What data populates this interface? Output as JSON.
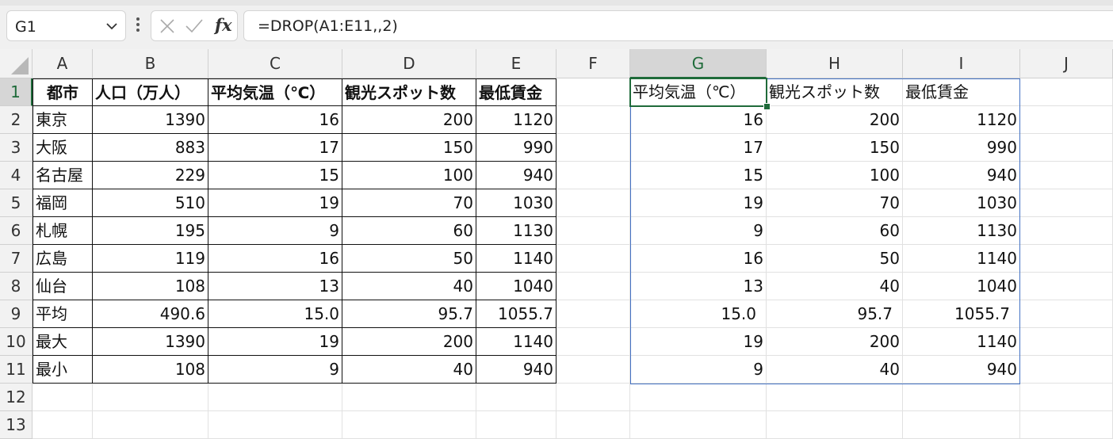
{
  "name_box": {
    "value": "G1"
  },
  "formula_bar": {
    "formula": "=DROP(A1:E11,,2)",
    "fx_label": "fx"
  },
  "columns": [
    "A",
    "B",
    "C",
    "D",
    "E",
    "F",
    "G",
    "H",
    "I",
    "J"
  ],
  "rows": [
    "1",
    "2",
    "3",
    "4",
    "5",
    "6",
    "7",
    "8",
    "9",
    "10",
    "11",
    "12",
    "13"
  ],
  "selected_cell": {
    "column": "G",
    "row": "1"
  },
  "source_table": {
    "headers": [
      "都市",
      "人口（万人）",
      "平均気温（℃）",
      "観光スポット数",
      "最低賃金"
    ],
    "rows": [
      [
        "東京",
        "1390",
        "16",
        "200",
        "1120"
      ],
      [
        "大阪",
        "883",
        "17",
        "150",
        "990"
      ],
      [
        "名古屋",
        "229",
        "15",
        "100",
        "940"
      ],
      [
        "福岡",
        "510",
        "19",
        "70",
        "1030"
      ],
      [
        "札幌",
        "195",
        "9",
        "60",
        "1130"
      ],
      [
        "広島",
        "119",
        "16",
        "50",
        "1140"
      ],
      [
        "仙台",
        "108",
        "13",
        "40",
        "1040"
      ],
      [
        "平均",
        "490.6",
        "15.0",
        "95.7",
        "1055.7"
      ],
      [
        "最大",
        "1390",
        "19",
        "200",
        "1140"
      ],
      [
        "最小",
        "108",
        "9",
        "40",
        "940"
      ]
    ]
  },
  "spill_result": {
    "headers": [
      "平均気温（℃）",
      "観光スポット数",
      "最低賃金"
    ],
    "rows": [
      [
        "16",
        "200",
        "1120"
      ],
      [
        "17",
        "150",
        "990"
      ],
      [
        "15",
        "100",
        "940"
      ],
      [
        "19",
        "70",
        "1030"
      ],
      [
        "9",
        "60",
        "1130"
      ],
      [
        "16",
        "50",
        "1140"
      ],
      [
        "13",
        "40",
        "1040"
      ],
      [
        "15.0",
        "95.7",
        "1055.7"
      ],
      [
        "19",
        "200",
        "1140"
      ],
      [
        "9",
        "40",
        "940"
      ]
    ]
  },
  "colors": {
    "selection": "#1f6b3a",
    "spill_border": "#4472c4",
    "grid_line": "#e1e1e1"
  }
}
